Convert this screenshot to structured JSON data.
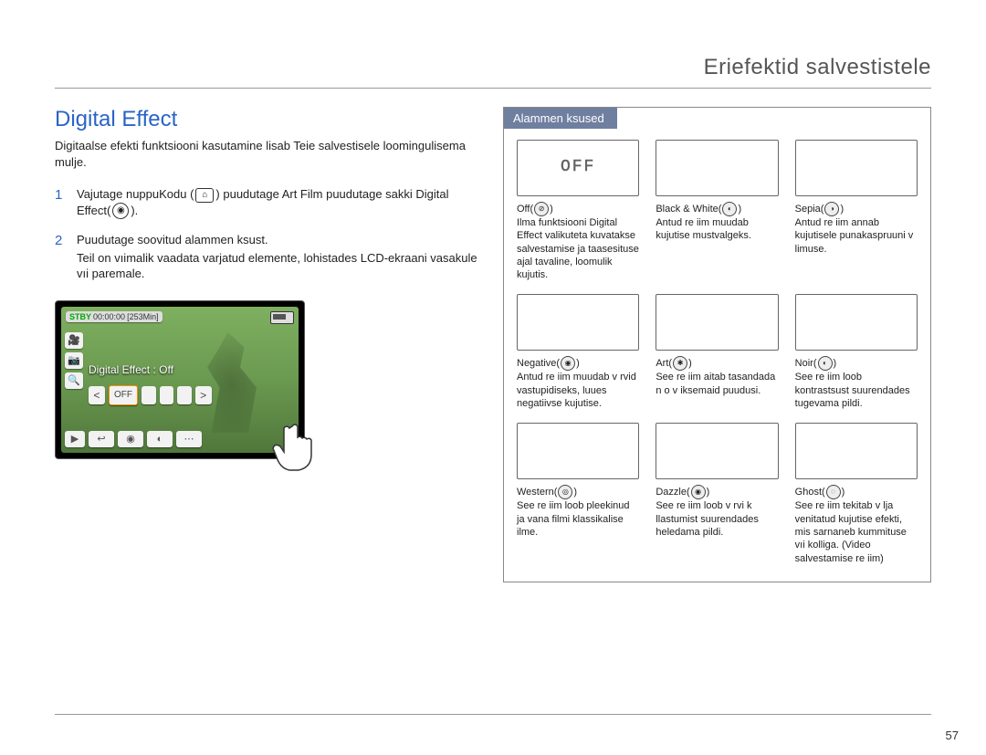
{
  "chapter_title": "Eriefektid salvestistele",
  "page_number": "57",
  "section_title": "Digital Effect",
  "intro": "Digitaalse efekti funktsiooni kasutamine lisab Teie salvestisele loomingulisema mulje.",
  "steps": {
    "s1a": "Vajutage nuppuKodu (",
    "s1b": ")   puudutage  Art Film   puudutage sakki Digital Effect(",
    "s1c": ").",
    "s2a": "Puudutage soovitud alammen    ksust.",
    "s2b": "Teil on vıimalik vaadata varjatud elemente, lohistades LCD-ekraani vasakule vıi paremale."
  },
  "device": {
    "stby": "STBY",
    "time": "00:00:00",
    "remain": "[253Min]",
    "label": "Digital Effect : Off",
    "chip": "OFF"
  },
  "subhead": "Alammen    ksused",
  "options": [
    {
      "name": "Off",
      "icon": "⊘",
      "thumb": "OFF",
      "desc": "Ilma funktsiooni Digital Effect valikuteta kuvatakse salvestamise ja taasesituse ajal tavaline, loomulik kujutis."
    },
    {
      "name": "Black & White",
      "icon": "◐",
      "thumb": "",
      "desc": "Antud re iim muudab kujutise mustvalgeks."
    },
    {
      "name": "Sepia",
      "icon": "◑",
      "thumb": "",
      "desc": "Antud re iim annab kujutisele punakaspruuni v limuse."
    },
    {
      "name": "Negative",
      "icon": "◉",
      "thumb": "",
      "desc": "Antud re iim muudab v rvid vastupidiseks, luues negatiivse kujutise."
    },
    {
      "name": "Art",
      "icon": "✱",
      "thumb": "",
      "desc": "See re iim aitab tasandada n o v iksemaid puudusi."
    },
    {
      "name": "Noir",
      "icon": "◐",
      "thumb": "",
      "desc": "See re iim loob kontrastsust suurendades tugevama pildi."
    },
    {
      "name": "Western",
      "icon": "◎",
      "thumb": "",
      "desc": "See re iim loob pleekinud ja vana filmi klassikalise ilme."
    },
    {
      "name": "Dazzle",
      "icon": "◉",
      "thumb": "",
      "desc": "See re iim loob v rvi k llastumist suurendades heledama pildi."
    },
    {
      "name": "Ghost",
      "icon": "◌",
      "thumb": "",
      "desc": "See re iim tekitab v lja venitatud kujutise efekti, mis sarnaneb kummituse vıi kolliga. (Video salvestamise re iim)"
    }
  ]
}
